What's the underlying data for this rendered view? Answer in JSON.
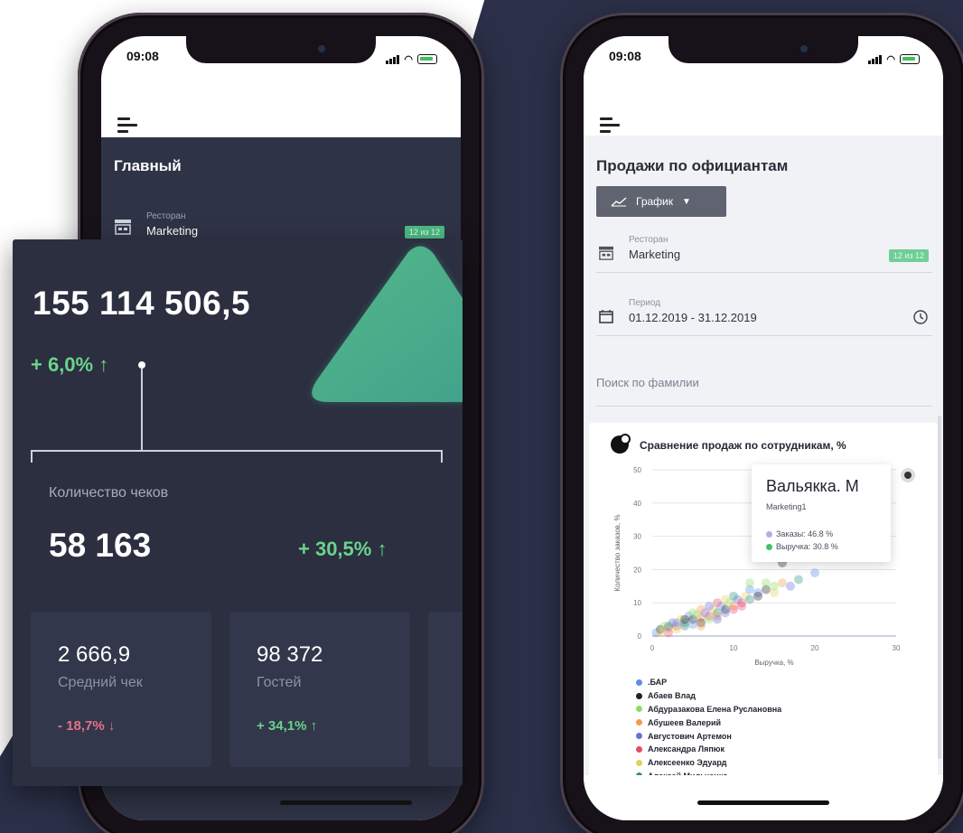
{
  "colors": {
    "navy": "#2b3048",
    "dark_card": "#2b2f40",
    "green": "#6bd48a",
    "red": "#e8708a",
    "badge": "#4cba84"
  },
  "phone1": {
    "status_time": "09:08",
    "title": "Главный",
    "restaurant_label": "Ресторан",
    "restaurant_value": "Marketing",
    "badge": "12 из 12",
    "total": "155 114 506,5",
    "total_change": "+ 6,0% ↑",
    "checks_label": "Количество чеков",
    "checks_value": "58 163",
    "checks_change": "+ 30,5% ↑",
    "cards": [
      {
        "value": "2 666,9",
        "label": "Средний чек",
        "change": "- 18,7% ↓"
      },
      {
        "value": "98 372",
        "label": "Гостей",
        "change": "+ 34,1% ↑"
      }
    ]
  },
  "phone2": {
    "status_time": "09:08",
    "title": "Продажи по официантам",
    "view_button": "График",
    "restaurant_label": "Ресторан",
    "restaurant_value": "Marketing",
    "badge": "12 из 12",
    "period_label": "Период",
    "period_value": "01.12.2019 - 31.12.2019",
    "search_placeholder": "Поиск по фамилии",
    "chart_title": "Сравнение продаж по сотрудникам, %",
    "tooltip": {
      "name": "Вальякка. М",
      "sub": "Marketing1",
      "rows": [
        "Заказы: 46.8 %",
        "Выручка: 30.8 %"
      ],
      "row_colors": [
        "#b9a9e8",
        "#3fc46a"
      ]
    }
  },
  "chart_data": {
    "type": "scatter",
    "title": "Сравнение продаж по сотрудникам, %",
    "xlabel": "Выручка, %",
    "ylabel": "Количество заказов, %",
    "xlim": [
      0,
      30
    ],
    "ylim": [
      0,
      50
    ],
    "x_ticks": [
      0,
      10,
      20,
      30
    ],
    "y_ticks": [
      0,
      10,
      20,
      30,
      40,
      50
    ],
    "legend_placement": "bottom",
    "series": [
      {
        "name": ".БАР",
        "color": "#5b8ee8"
      },
      {
        "name": "Абаев Влад",
        "color": "#222222"
      },
      {
        "name": "Абдуразакова Елена Руслановна",
        "color": "#8fdc66"
      },
      {
        "name": "Абушеев Валерий",
        "color": "#f29a52"
      },
      {
        "name": "Августович Артемон",
        "color": "#6a6ee0"
      },
      {
        "name": "Александра Ляпюк",
        "color": "#e24a6e"
      },
      {
        "name": "Алексеенко Эдуард",
        "color": "#e2d15a"
      },
      {
        "name": "Алексей Мильченко",
        "color": "#2d8f86"
      }
    ],
    "points": [
      [
        0.5,
        1
      ],
      [
        1,
        2
      ],
      [
        1.5,
        3
      ],
      [
        2,
        2.5
      ],
      [
        2.5,
        4
      ],
      [
        3,
        3
      ],
      [
        3.5,
        5
      ],
      [
        4,
        4
      ],
      [
        4.5,
        6
      ],
      [
        5,
        5
      ],
      [
        5.5,
        6.5
      ],
      [
        6,
        5.5
      ],
      [
        6.5,
        7
      ],
      [
        7,
        6
      ],
      [
        7.5,
        8
      ],
      [
        8,
        7
      ],
      [
        8.5,
        9
      ],
      [
        9,
        8
      ],
      [
        9.5,
        10
      ],
      [
        10,
        9
      ],
      [
        10.5,
        11
      ],
      [
        11,
        10
      ],
      [
        11.5,
        12
      ],
      [
        12,
        11
      ],
      [
        13,
        13
      ],
      [
        14,
        14
      ],
      [
        15,
        15
      ],
      [
        16,
        16
      ],
      [
        17,
        15
      ],
      [
        2,
        1
      ],
      [
        3,
        2
      ],
      [
        4,
        3
      ],
      [
        5,
        3.5
      ],
      [
        6,
        4
      ],
      [
        7,
        5
      ],
      [
        8,
        6
      ],
      [
        9,
        7
      ],
      [
        10,
        8
      ],
      [
        1,
        1
      ],
      [
        2,
        3
      ],
      [
        3,
        4
      ],
      [
        4,
        5
      ],
      [
        5,
        7
      ],
      [
        6,
        8
      ],
      [
        7,
        9
      ],
      [
        8,
        10
      ],
      [
        9,
        11
      ],
      [
        10,
        12
      ],
      [
        12,
        14
      ],
      [
        13,
        12
      ],
      [
        14,
        16
      ],
      [
        6,
        3
      ],
      [
        8,
        5
      ],
      [
        11,
        9
      ],
      [
        15,
        13
      ],
      [
        18,
        17
      ],
      [
        20,
        19
      ],
      [
        16,
        22
      ],
      [
        12,
        16
      ],
      [
        24,
        24
      ]
    ]
  }
}
